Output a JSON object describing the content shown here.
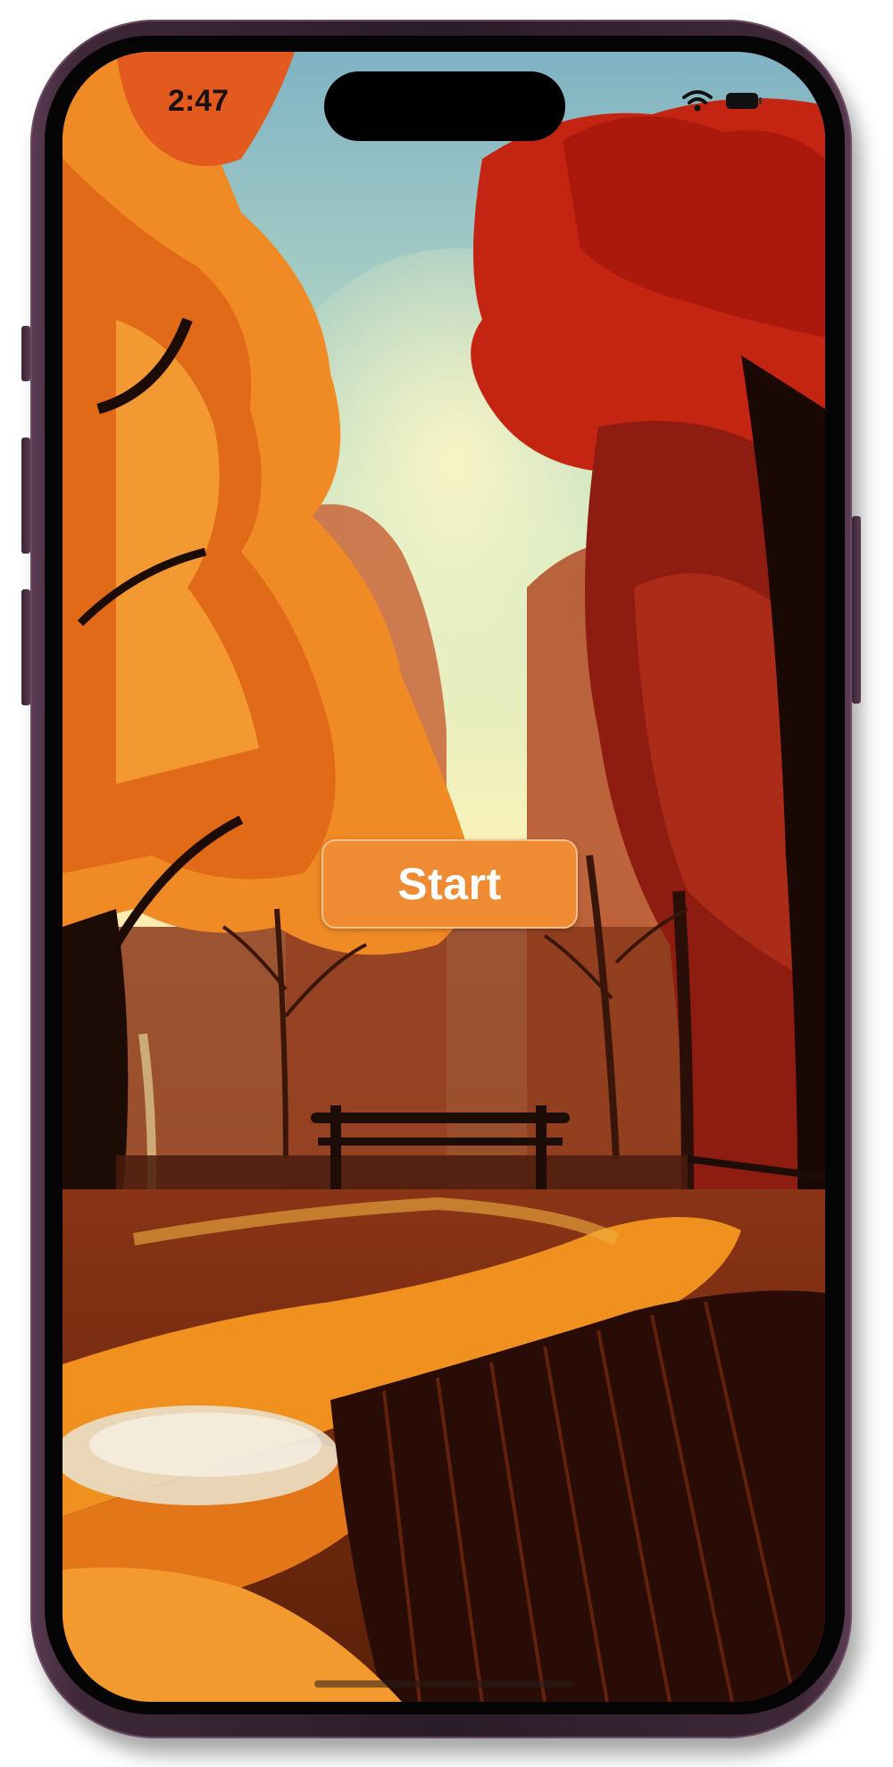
{
  "status_bar": {
    "time": "2:47",
    "wifi_icon": "wifi-icon",
    "battery_icon": "battery-icon"
  },
  "main": {
    "start_label": "Start"
  },
  "colors": {
    "button": "#ef8c33",
    "button_text": "#ffffff",
    "frame": "#3e2838"
  }
}
